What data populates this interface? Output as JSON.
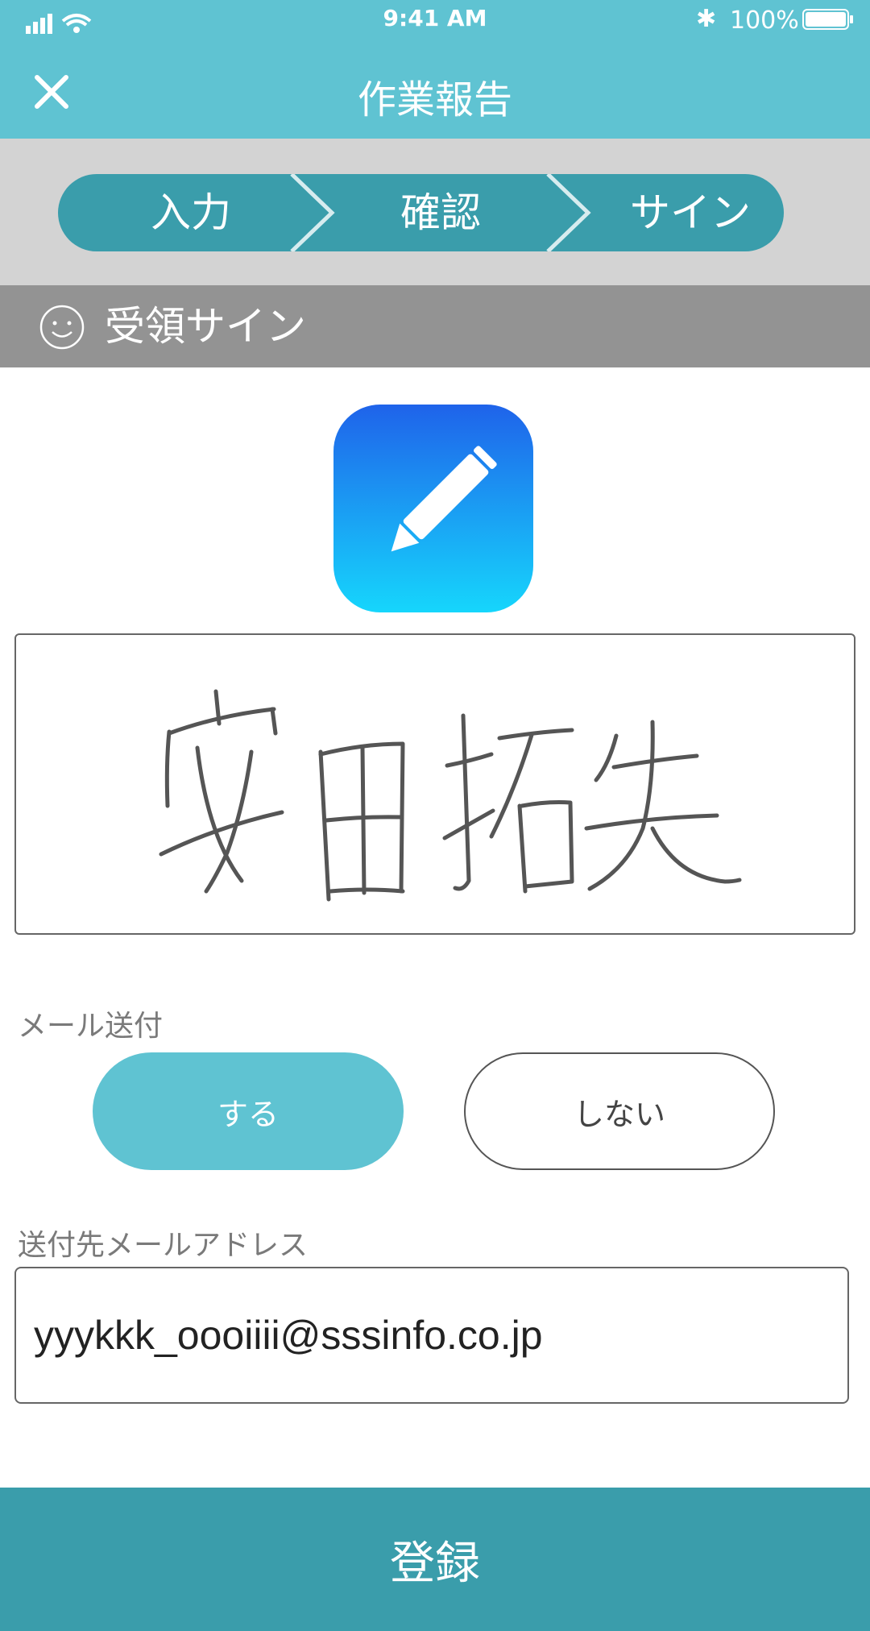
{
  "status_bar": {
    "time": "9:41 AM",
    "battery": "100%",
    "bluetooth_symbol": "✱"
  },
  "nav": {
    "title": "作業報告",
    "close_icon": "close-icon"
  },
  "stepper": {
    "steps": [
      "入力",
      "確認",
      "サイン"
    ]
  },
  "section": {
    "title": "受領サイン",
    "icon": "smiley-icon"
  },
  "signature": {
    "handwritten_name": "安田拓矢"
  },
  "mail_send": {
    "label": "メール送付",
    "options": [
      "する",
      "しない"
    ],
    "selected": "する"
  },
  "address": {
    "label": "送付先メールアドレス",
    "value": "yyykkk_oooiiii@sssinfo.co.jp"
  },
  "submit": {
    "label": "登録"
  },
  "colors": {
    "header": "#5fc3d2",
    "stepper_fill": "#3a9dab",
    "section_header": "#939393",
    "selected_pill": "#5fc3d2",
    "bottom_button": "#3a9dab"
  }
}
